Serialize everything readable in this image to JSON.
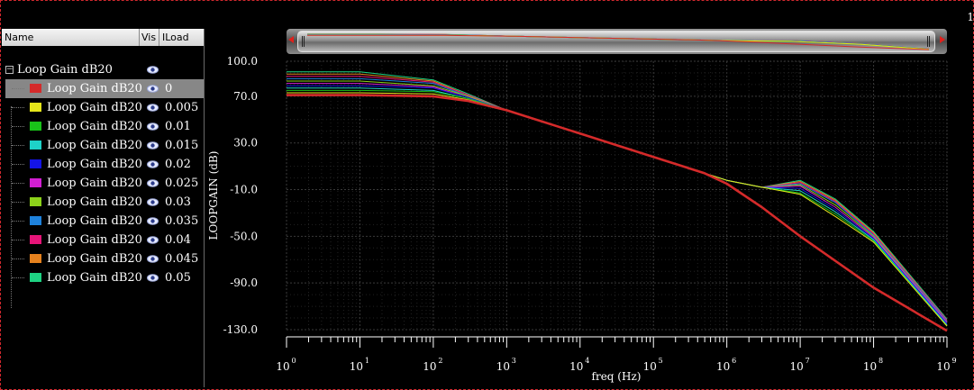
{
  "panel": {
    "columns": [
      "Name",
      "Vis",
      "ILoad"
    ],
    "group": {
      "name": "Loop Gain dB20",
      "expander": "−"
    },
    "rows": [
      {
        "name": "Loop Gain dB20",
        "load": "0",
        "color": "#d42a2a"
      },
      {
        "name": "Loop Gain dB20",
        "load": "0.005",
        "color": "#e6e61a"
      },
      {
        "name": "Loop Gain dB20",
        "load": "0.01",
        "color": "#19c319"
      },
      {
        "name": "Loop Gain dB20",
        "load": "0.015",
        "color": "#1ed2c8"
      },
      {
        "name": "Loop Gain dB20",
        "load": "0.02",
        "color": "#1414e6"
      },
      {
        "name": "Loop Gain dB20",
        "load": "0.025",
        "color": "#d21ed2"
      },
      {
        "name": "Loop Gain dB20",
        "load": "0.03",
        "color": "#8cd21a"
      },
      {
        "name": "Loop Gain dB20",
        "load": "0.035",
        "color": "#1e82dc"
      },
      {
        "name": "Loop Gain dB20",
        "load": "0.04",
        "color": "#e61478"
      },
      {
        "name": "Loop Gain dB20",
        "load": "0.045",
        "color": "#e6821e"
      },
      {
        "name": "Loop Gain dB20",
        "load": "0.05",
        "color": "#1ed282"
      }
    ]
  },
  "corner_label": "1",
  "chart_data": {
    "type": "line",
    "xlabel": "freq (Hz)",
    "ylabel": "LOOPGAIN (dB)",
    "xscale": "log",
    "xlim": [
      1,
      1000000000
    ],
    "ylim": [
      -130,
      100
    ],
    "yticks": [
      -130,
      -90,
      -50,
      -10,
      30,
      70,
      100
    ],
    "ytick_labels": [
      "-130.0",
      "-90.0",
      "-50.0",
      "-10.0",
      "30.0",
      "70.0",
      "100.0"
    ],
    "xticks": [
      1,
      10,
      100,
      1000,
      10000,
      100000,
      1000000,
      10000000,
      100000000,
      1000000000
    ],
    "xtick_labels": [
      {
        "base": "10",
        "exp": "0"
      },
      {
        "base": "10",
        "exp": "1"
      },
      {
        "base": "10",
        "exp": "2"
      },
      {
        "base": "10",
        "exp": "3"
      },
      {
        "base": "10",
        "exp": "4"
      },
      {
        "base": "10",
        "exp": "5"
      },
      {
        "base": "10",
        "exp": "6"
      },
      {
        "base": "10",
        "exp": "7"
      },
      {
        "base": "10",
        "exp": "8"
      },
      {
        "base": "10",
        "exp": "9"
      }
    ],
    "grid": true,
    "series": [
      {
        "name": "0",
        "color": "#d42a2a",
        "x": [
          1,
          10,
          100,
          300,
          1000,
          10000,
          100000,
          500000,
          1000000,
          3000000,
          10000000,
          100000000,
          1000000000
        ],
        "y": [
          71,
          71,
          70,
          66,
          58,
          38,
          18,
          4,
          -5,
          -25,
          -50,
          -94,
          -131
        ]
      },
      {
        "name": "0.005",
        "color": "#e6e61a",
        "x": [
          1,
          10,
          100,
          300,
          1000,
          10000,
          100000,
          1000000,
          3000000,
          10000000,
          30000000,
          100000000,
          1000000000
        ],
        "y": [
          73,
          73,
          72,
          67,
          58,
          38,
          18,
          -2,
          -8,
          -14,
          -33,
          -55,
          -127
        ]
      },
      {
        "name": "0.01",
        "color": "#19c319",
        "x": [
          1,
          10,
          100,
          300,
          1000,
          10000,
          100000,
          1000000,
          3000000,
          10000000,
          30000000,
          100000000,
          1000000000
        ],
        "y": [
          75,
          75,
          74,
          68,
          58,
          38,
          18,
          -2,
          -8,
          -13,
          -31,
          -54,
          -127
        ]
      },
      {
        "name": "0.015",
        "color": "#1ed2c8",
        "x": [
          1,
          10,
          100,
          300,
          1000,
          10000,
          100000,
          1000000,
          3000000,
          10000000,
          30000000,
          100000000,
          1000000000
        ],
        "y": [
          77,
          77,
          75,
          68,
          58,
          38,
          18,
          -2,
          -8,
          -11,
          -29,
          -53,
          -126
        ]
      },
      {
        "name": "0.02",
        "color": "#1414e6",
        "x": [
          1,
          10,
          100,
          300,
          1000,
          10000,
          100000,
          1000000,
          3000000,
          10000000,
          30000000,
          100000000,
          1000000000
        ],
        "y": [
          79,
          79,
          77,
          69,
          58,
          38,
          18,
          -2,
          -8,
          -9,
          -27,
          -52,
          -125
        ]
      },
      {
        "name": "0.025",
        "color": "#d21ed2",
        "x": [
          1,
          10,
          100,
          300,
          1000,
          10000,
          100000,
          1000000,
          3000000,
          10000000,
          30000000,
          100000000,
          1000000000
        ],
        "y": [
          81,
          81,
          78,
          69,
          58,
          38,
          18,
          -2,
          -8,
          -7,
          -25,
          -51,
          -124
        ]
      },
      {
        "name": "0.03",
        "color": "#8cd21a",
        "x": [
          1,
          10,
          100,
          300,
          1000,
          10000,
          100000,
          1000000,
          3000000,
          10000000,
          30000000,
          100000000,
          1000000000
        ],
        "y": [
          83,
          83,
          79,
          70,
          58,
          38,
          18,
          -2,
          -8,
          -6,
          -23,
          -50,
          -124
        ]
      },
      {
        "name": "0.035",
        "color": "#1e82dc",
        "x": [
          1,
          10,
          100,
          300,
          1000,
          10000,
          100000,
          1000000,
          3000000,
          10000000,
          30000000,
          100000000,
          1000000000
        ],
        "y": [
          85,
          85,
          81,
          70,
          58,
          38,
          18,
          -2,
          -8,
          -5,
          -21,
          -49,
          -123
        ]
      },
      {
        "name": "0.04",
        "color": "#e61478",
        "x": [
          1,
          10,
          100,
          300,
          1000,
          10000,
          100000,
          1000000,
          3000000,
          10000000,
          30000000,
          100000000,
          1000000000
        ],
        "y": [
          87,
          87,
          82,
          71,
          58,
          38,
          18,
          -2,
          -8,
          -4,
          -20,
          -48,
          -122
        ]
      },
      {
        "name": "0.045",
        "color": "#e6821e",
        "x": [
          1,
          10,
          100,
          300,
          1000,
          10000,
          100000,
          1000000,
          3000000,
          10000000,
          30000000,
          100000000,
          1000000000
        ],
        "y": [
          89,
          89,
          83,
          71,
          58,
          38,
          18,
          -2,
          -8,
          -3,
          -19,
          -47,
          -122
        ]
      },
      {
        "name": "0.05",
        "color": "#1ed282",
        "x": [
          1,
          10,
          100,
          300,
          1000,
          10000,
          100000,
          1000000,
          3000000,
          10000000,
          30000000,
          100000000,
          1000000000
        ],
        "y": [
          91,
          91,
          84,
          72,
          58,
          38,
          18,
          -2,
          -8,
          -2,
          -18,
          -46,
          -121
        ]
      }
    ]
  }
}
